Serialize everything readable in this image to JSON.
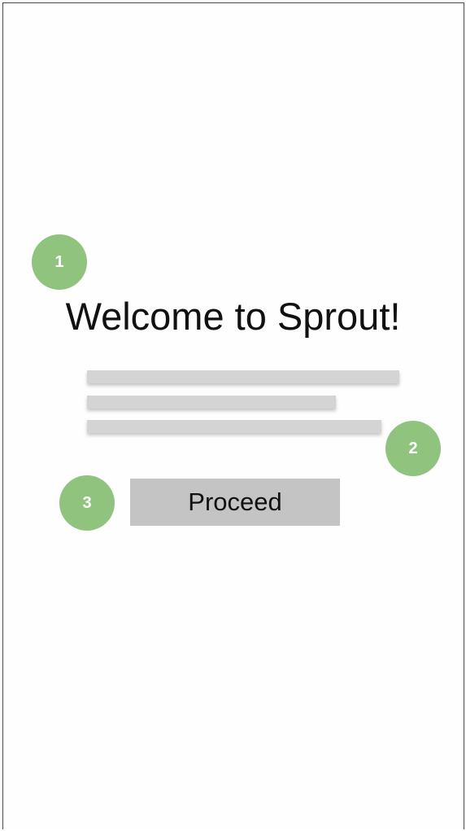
{
  "screen": {
    "title": "Welcome to Sprout!",
    "description_lines": [
      "",
      "",
      ""
    ],
    "proceed_label": "Proceed"
  },
  "annotations": {
    "markers": [
      "1",
      "2",
      "3"
    ],
    "marker_color": "#8fc37e"
  },
  "colors": {
    "placeholder_bar": "#d4d4d4",
    "button_background": "#c4c4c4",
    "frame_border": "#4a4a4a"
  }
}
